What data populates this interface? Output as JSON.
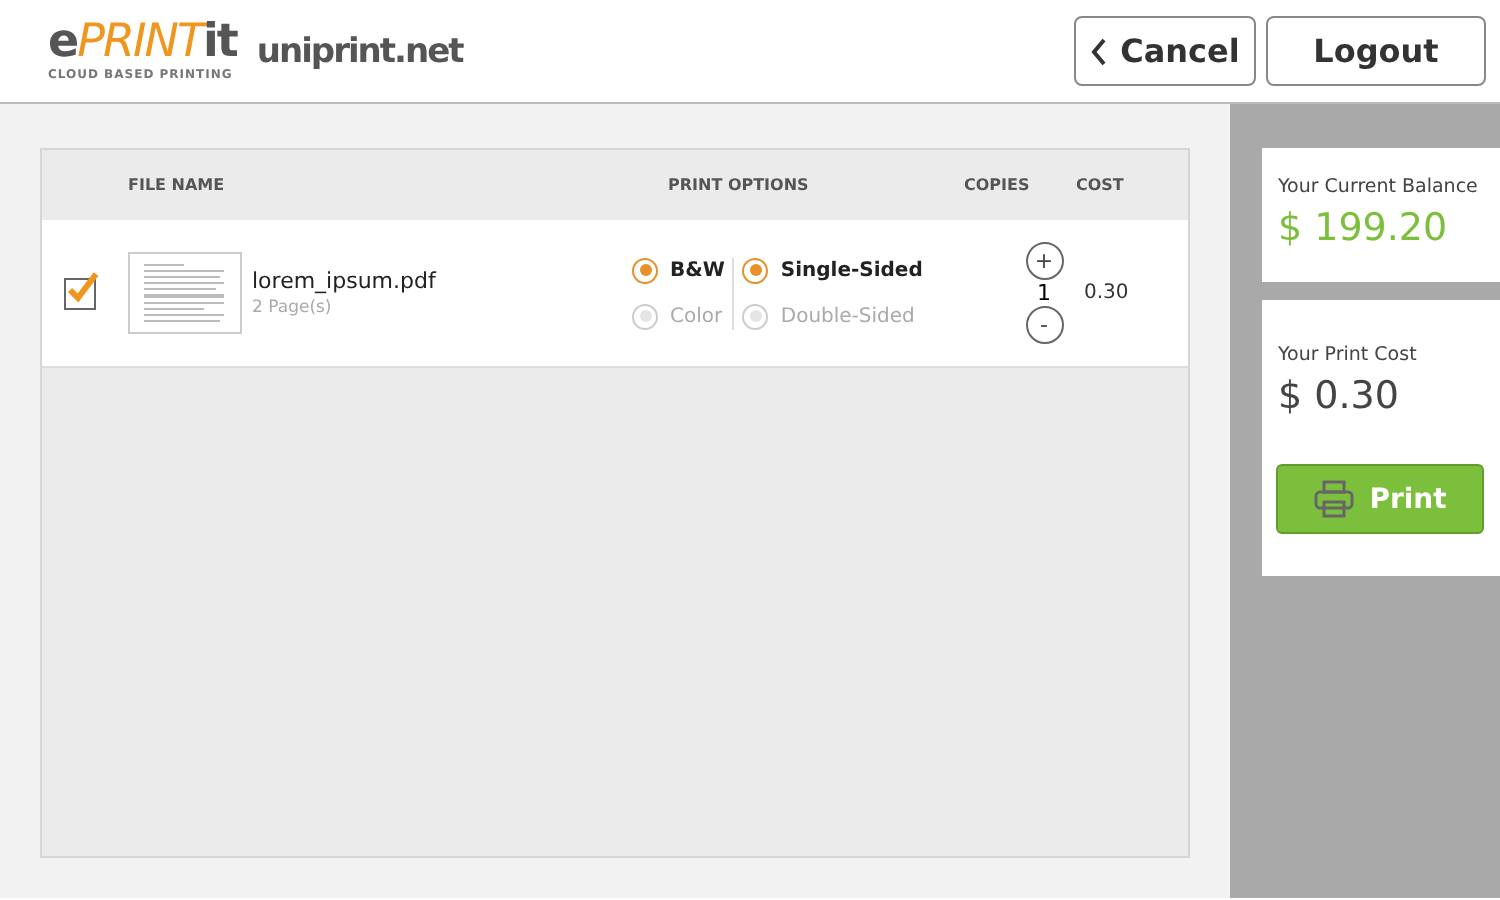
{
  "header": {
    "logo": {
      "parts": [
        {
          "text": "e",
          "kind": "plain"
        },
        {
          "text": "PRINT",
          "kind": "accent"
        },
        {
          "text": "it",
          "kind": "plain"
        }
      ],
      "tagline": "CLOUD BASED PRINTING"
    },
    "partner_logo": "uniprint.net",
    "buttons": [
      {
        "label": "Cancel",
        "kind": "back"
      },
      {
        "label": "Logout",
        "kind": "plain"
      }
    ]
  },
  "table": {
    "columns": [
      "FILE NAME",
      "PRINT OPTIONS",
      "COPIES",
      "COST"
    ],
    "rows": [
      {
        "checked": true,
        "file_name": "lorem_ipsum.pdf",
        "pages": "2 Page(s)",
        "color_options": [
          {
            "label": "B&W",
            "selected": true
          },
          {
            "label": "Color",
            "selected": false
          }
        ],
        "side_options": [
          {
            "label": "Single-Sided",
            "selected": true
          },
          {
            "label": "Double-Sided",
            "selected": false
          }
        ],
        "increment": "+",
        "copies": "1",
        "decrement": "-",
        "cost": "0.30"
      }
    ]
  },
  "sidebar": {
    "balance": {
      "label": "Your Current Balance",
      "value": "$ 199.20"
    },
    "print_cost": {
      "label": "Your Print Cost",
      "value": "$ 0.30"
    },
    "print_button": "Print"
  }
}
